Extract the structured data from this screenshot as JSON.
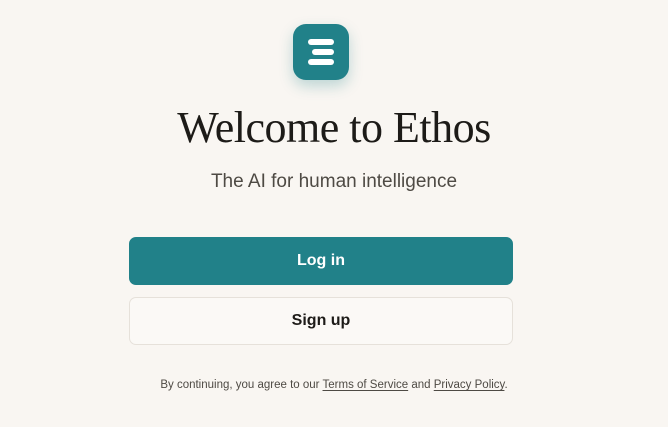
{
  "brand": {
    "logo_icon": "ethos-logo-icon",
    "accent_color": "#218189"
  },
  "welcome": {
    "title": "Welcome to Ethos",
    "subtitle": "The AI for human intelligence"
  },
  "actions": {
    "login_label": "Log in",
    "signup_label": "Sign up"
  },
  "legal": {
    "prefix": "By continuing, you agree to our ",
    "terms_link": "Terms of Service",
    "conjunction": " and ",
    "privacy_link": "Privacy Policy",
    "suffix": "."
  }
}
